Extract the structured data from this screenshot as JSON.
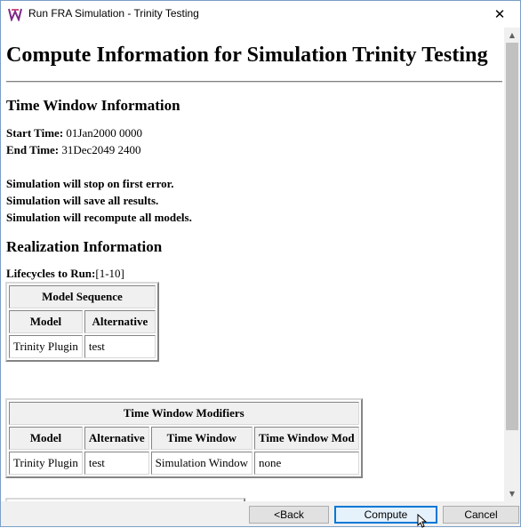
{
  "window": {
    "title": "Run FRA Simulation - Trinity Testing",
    "close_glyph": "✕"
  },
  "content": {
    "heading": "Compute Information for Simulation Trinity Testing",
    "time_window": {
      "heading": "Time Window Information",
      "start_label": "Start Time:",
      "start_value": "01Jan2000 0000",
      "end_label": "End Time:",
      "end_value": "31Dec2049 2400"
    },
    "notes": [
      "Simulation will stop on first error.",
      "Simulation will save all results.",
      "Simulation will recompute all models."
    ],
    "realization": {
      "heading": "Realization Information",
      "lifecycles_label": "Lifecycles to Run:",
      "lifecycles_value": "[1-10]"
    },
    "model_sequence": {
      "title": "Model Sequence",
      "columns": [
        "Model",
        "Alternative"
      ],
      "rows": [
        [
          "Trinity Plugin",
          "test"
        ]
      ]
    },
    "time_window_modifiers": {
      "title": "Time Window Modifiers",
      "columns": [
        "Model",
        "Alternative",
        "Time Window",
        "Time Window Mod"
      ],
      "rows": [
        [
          "Trinity Plugin",
          "test",
          "Simulation Window",
          "none"
        ]
      ]
    }
  },
  "scrollbar": {
    "up_glyph": "▲",
    "down_glyph": "▼"
  },
  "buttons": {
    "back": "<Back",
    "compute": "Compute",
    "cancel": "Cancel"
  },
  "colors": {
    "accent": "#0078d7",
    "footer_bg": "#f0f0f0",
    "button_bg": "#e1e1e1"
  }
}
